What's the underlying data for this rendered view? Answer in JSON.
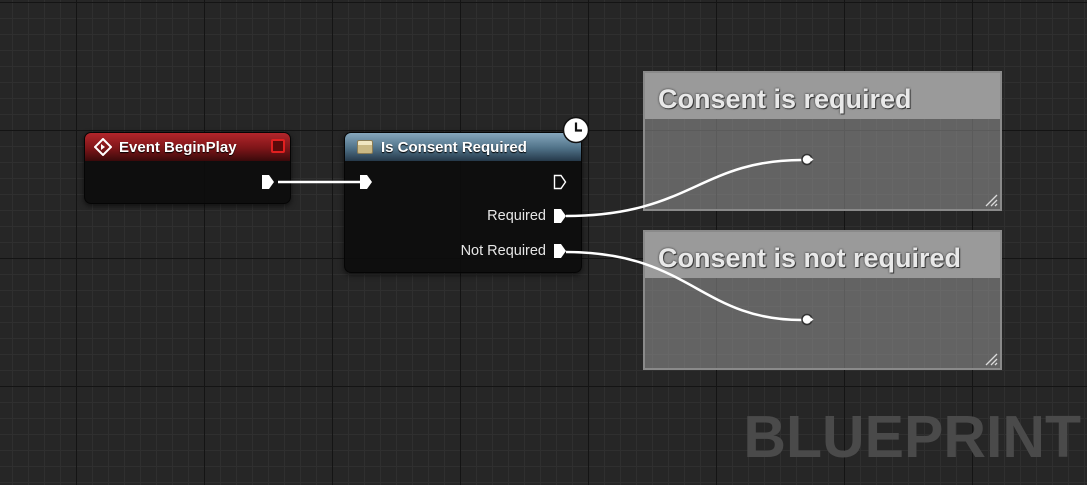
{
  "nodes": {
    "event_begin_play": {
      "title": "Event BeginPlay"
    },
    "is_consent_required": {
      "title": "Is Consent Required",
      "outputs": [
        "Required",
        "Not Required"
      ]
    }
  },
  "comments": [
    {
      "title": "Consent is required"
    },
    {
      "title": "Consent is not required"
    }
  ],
  "watermark": "BLUEPRINT",
  "colors": {
    "event_header": "#7d1518",
    "function_header": "#4f7187",
    "wire": "#ffffff",
    "comment_bg": "#9a9a9a",
    "grid_bg": "#262626"
  },
  "icons": [
    "event-diamond-icon",
    "delegate-pin-icon",
    "function-icon",
    "latent-clock-icon",
    "exec-pin-icon",
    "resize-grip-icon"
  ]
}
